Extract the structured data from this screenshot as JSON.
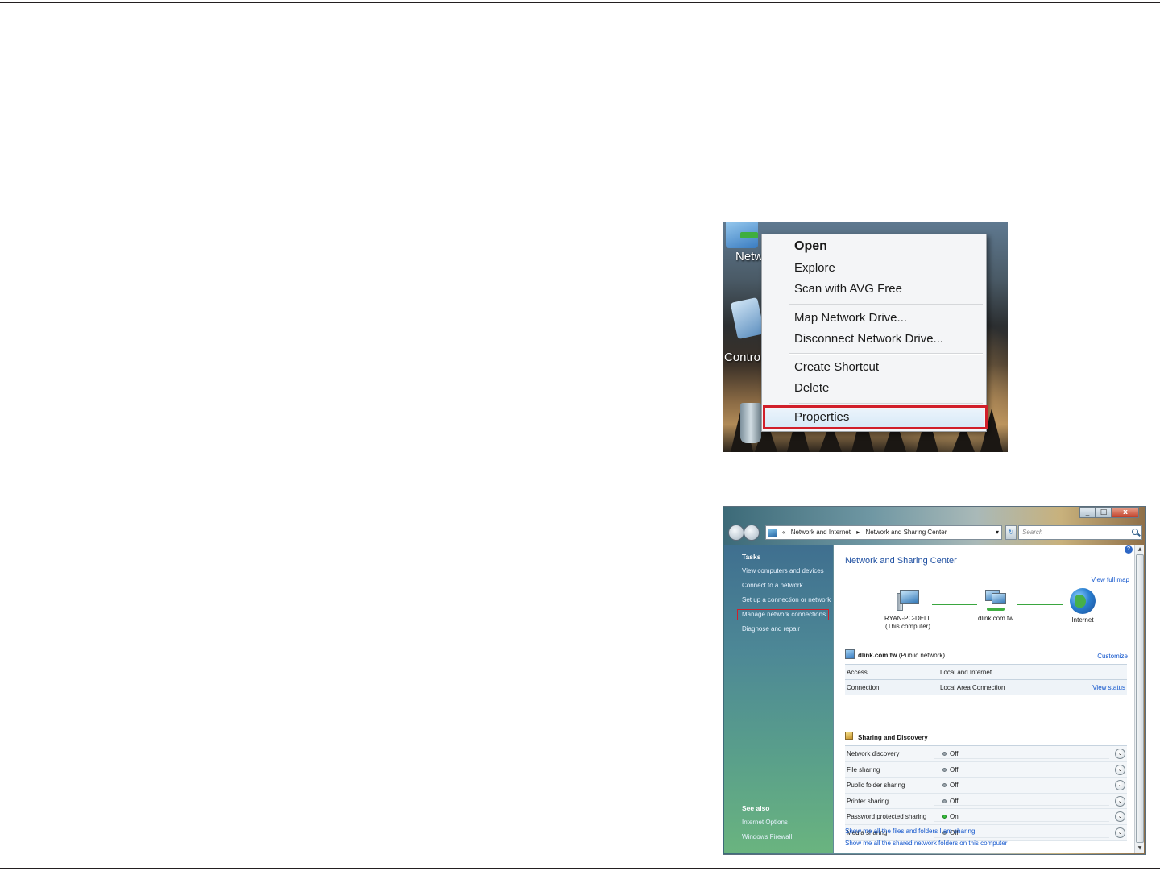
{
  "context_menu_screenshot": {
    "desktop_labels": {
      "network": "Netw",
      "control": "Contro"
    },
    "items": [
      {
        "label": "Open"
      },
      {
        "label": "Explore"
      },
      {
        "label": "Scan with AVG Free"
      },
      {
        "label": "Map Network Drive..."
      },
      {
        "label": "Disconnect Network Drive..."
      },
      {
        "label": "Create Shortcut"
      },
      {
        "label": "Delete"
      },
      {
        "label": "Properties"
      }
    ],
    "highlight_color": "#d11f2a"
  },
  "sharing_center_screenshot": {
    "window_buttons": {
      "minimize": "_",
      "maximize": "□",
      "close": "x"
    },
    "address": {
      "prefix": "«",
      "crumb1": "Network and Internet",
      "crumb2": "Network and Sharing Center",
      "separator": "▸",
      "dropdown": "▾"
    },
    "refresh_label": "↻",
    "search_placeholder": "Search",
    "help_label": "?",
    "tasks": {
      "heading": "Tasks",
      "links": [
        "View computers and devices",
        "Connect to a network",
        "Set up a connection or network",
        "Manage network connections",
        "Diagnose and repair"
      ]
    },
    "see_also": {
      "heading": "See also",
      "links": [
        "Internet Options",
        "Windows Firewall"
      ]
    },
    "title": "Network and Sharing Center",
    "view_full_map": "View full map",
    "map": {
      "computer": "RYAN-PC-DELL",
      "computer_sub": "(This computer)",
      "network": "dlink.com.tw",
      "internet": "Internet"
    },
    "network": {
      "name": "dlink.com.tw",
      "type": "(Public network)",
      "customize": "Customize",
      "rows": [
        {
          "key": "Access",
          "value": "Local and Internet",
          "action": ""
        },
        {
          "key": "Connection",
          "value": "Local Area Connection",
          "action": "View status"
        }
      ]
    },
    "sharing": {
      "heading": "Sharing and Discovery",
      "expand_glyph": "⌄",
      "rows": [
        {
          "key": "Network discovery",
          "value": "Off"
        },
        {
          "key": "File sharing",
          "value": "Off"
        },
        {
          "key": "Public folder sharing",
          "value": "Off"
        },
        {
          "key": "Printer sharing",
          "value": "Off"
        },
        {
          "key": "Password protected sharing",
          "value": "On"
        },
        {
          "key": "Media sharing",
          "value": "Off"
        }
      ]
    },
    "bottom_links": [
      "Show me all the files and folders I am sharing",
      "Show me all the shared network folders on this computer"
    ],
    "scroll_up": "▲",
    "scroll_down": "▼"
  }
}
